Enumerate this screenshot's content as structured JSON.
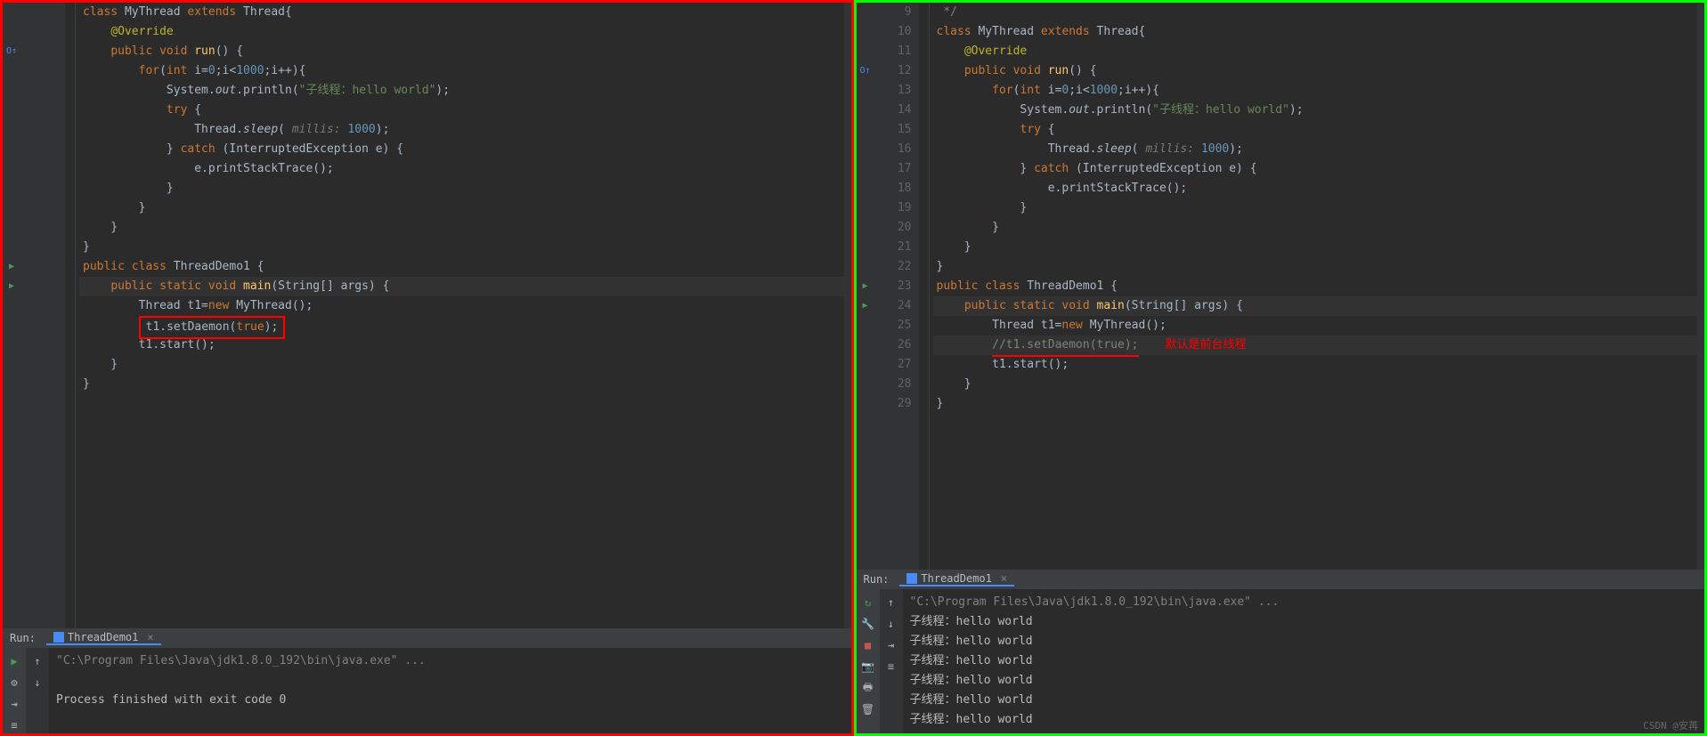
{
  "left": {
    "lines_start": 1,
    "code": [
      {
        "n": "",
        "tokens": [
          {
            "t": "class ",
            "c": "kw"
          },
          {
            "t": "MyThread ",
            "c": ""
          },
          {
            "t": "extends ",
            "c": "kw"
          },
          {
            "t": "Thread",
            "c": ""
          },
          {
            "t": "{",
            "c": ""
          }
        ]
      },
      {
        "n": "",
        "tokens": [
          {
            "t": "    ",
            "c": ""
          },
          {
            "t": "@Override",
            "c": "anno"
          }
        ]
      },
      {
        "n": "",
        "icon": "override",
        "tokens": [
          {
            "t": "    ",
            "c": ""
          },
          {
            "t": "public void ",
            "c": "kw"
          },
          {
            "t": "run",
            "c": "fn"
          },
          {
            "t": "() {",
            "c": ""
          }
        ]
      },
      {
        "n": "",
        "tokens": [
          {
            "t": "        ",
            "c": ""
          },
          {
            "t": "for",
            "c": "kw"
          },
          {
            "t": "(",
            "c": ""
          },
          {
            "t": "int ",
            "c": "kw"
          },
          {
            "t": "i=",
            "c": ""
          },
          {
            "t": "0",
            "c": "num"
          },
          {
            "t": ";i<",
            "c": ""
          },
          {
            "t": "1000",
            "c": "num"
          },
          {
            "t": ";i++){",
            "c": ""
          }
        ]
      },
      {
        "n": "",
        "tokens": [
          {
            "t": "            System.",
            "c": ""
          },
          {
            "t": "out",
            "c": "static"
          },
          {
            "t": ".println(",
            "c": ""
          },
          {
            "t": "\"子线程：hello world\"",
            "c": "str"
          },
          {
            "t": ");",
            "c": ""
          }
        ]
      },
      {
        "n": "",
        "tokens": [
          {
            "t": "            ",
            "c": ""
          },
          {
            "t": "try ",
            "c": "kw"
          },
          {
            "t": "{",
            "c": ""
          }
        ]
      },
      {
        "n": "",
        "tokens": [
          {
            "t": "                Thread.",
            "c": ""
          },
          {
            "t": "sleep",
            "c": "static"
          },
          {
            "t": "( ",
            "c": ""
          },
          {
            "t": "millis: ",
            "c": "hint"
          },
          {
            "t": "1000",
            "c": "num"
          },
          {
            "t": ");",
            "c": ""
          }
        ]
      },
      {
        "n": "",
        "tokens": [
          {
            "t": "            } ",
            "c": ""
          },
          {
            "t": "catch ",
            "c": "kw"
          },
          {
            "t": "(InterruptedException e) {",
            "c": ""
          }
        ]
      },
      {
        "n": "",
        "tokens": [
          {
            "t": "                e.printStackTrace();",
            "c": ""
          }
        ]
      },
      {
        "n": "",
        "tokens": [
          {
            "t": "            }",
            "c": ""
          }
        ]
      },
      {
        "n": "",
        "tokens": [
          {
            "t": "        }",
            "c": ""
          }
        ]
      },
      {
        "n": "",
        "tokens": [
          {
            "t": "    }",
            "c": ""
          }
        ]
      },
      {
        "n": "",
        "tokens": [
          {
            "t": "}",
            "c": ""
          }
        ]
      },
      {
        "n": "",
        "icon": "run",
        "tokens": [
          {
            "t": "public class ",
            "c": "kw"
          },
          {
            "t": "ThreadDemo1 {",
            "c": ""
          }
        ]
      },
      {
        "n": "",
        "icon": "run",
        "hl": true,
        "tokens": [
          {
            "t": "    ",
            "c": ""
          },
          {
            "t": "public static void ",
            "c": "kw"
          },
          {
            "t": "main",
            "c": "fn"
          },
          {
            "t": "(String[] args) {",
            "c": ""
          }
        ]
      },
      {
        "n": "",
        "tokens": [
          {
            "t": "        Thread t1=",
            "c": ""
          },
          {
            "t": "new ",
            "c": "kw"
          },
          {
            "t": "MyThread();",
            "c": ""
          }
        ]
      },
      {
        "n": "",
        "box": true,
        "tokens": [
          {
            "t": "        t1.setDaemon(",
            "c": ""
          },
          {
            "t": "true",
            "c": "kw"
          },
          {
            "t": ");",
            "c": ""
          }
        ]
      },
      {
        "n": "",
        "tokens": [
          {
            "t": "        t1.start();",
            "c": ""
          }
        ]
      },
      {
        "n": "",
        "tokens": [
          {
            "t": "    }",
            "c": ""
          }
        ]
      },
      {
        "n": "",
        "tokens": [
          {
            "t": "}",
            "c": ""
          }
        ]
      }
    ],
    "run": {
      "label": "Run:",
      "tab": "ThreadDemo1",
      "output": [
        {
          "text": "\"C:\\Program Files\\Java\\jdk1.8.0_192\\bin\\java.exe\" ...",
          "cls": "out-cmd"
        },
        {
          "text": " ",
          "cls": ""
        },
        {
          "text": "Process finished with exit code 0",
          "cls": ""
        },
        {
          "text": "",
          "cls": ""
        }
      ]
    }
  },
  "right": {
    "lines": [
      {
        "n": "9",
        "tokens": [
          {
            "t": " */",
            "c": "cmt"
          }
        ]
      },
      {
        "n": "10",
        "tokens": [
          {
            "t": "class ",
            "c": "kw"
          },
          {
            "t": "MyThread ",
            "c": ""
          },
          {
            "t": "extends ",
            "c": "kw"
          },
          {
            "t": "Thread",
            "c": ""
          },
          {
            "t": "{",
            "c": ""
          }
        ]
      },
      {
        "n": "11",
        "tokens": [
          {
            "t": "    ",
            "c": ""
          },
          {
            "t": "@Override",
            "c": "anno"
          }
        ]
      },
      {
        "n": "12",
        "icon": "override",
        "tokens": [
          {
            "t": "    ",
            "c": ""
          },
          {
            "t": "public void ",
            "c": "kw"
          },
          {
            "t": "run",
            "c": "fn"
          },
          {
            "t": "() {",
            "c": ""
          }
        ]
      },
      {
        "n": "13",
        "tokens": [
          {
            "t": "        ",
            "c": ""
          },
          {
            "t": "for",
            "c": "kw"
          },
          {
            "t": "(",
            "c": ""
          },
          {
            "t": "int ",
            "c": "kw"
          },
          {
            "t": "i=",
            "c": ""
          },
          {
            "t": "0",
            "c": "num"
          },
          {
            "t": ";i<",
            "c": ""
          },
          {
            "t": "1000",
            "c": "num"
          },
          {
            "t": ";i++){",
            "c": ""
          }
        ]
      },
      {
        "n": "14",
        "tokens": [
          {
            "t": "            System.",
            "c": ""
          },
          {
            "t": "out",
            "c": "static"
          },
          {
            "t": ".println(",
            "c": ""
          },
          {
            "t": "\"子线程：hello world\"",
            "c": "str"
          },
          {
            "t": ");",
            "c": ""
          }
        ]
      },
      {
        "n": "15",
        "tokens": [
          {
            "t": "            ",
            "c": ""
          },
          {
            "t": "try ",
            "c": "kw"
          },
          {
            "t": "{",
            "c": ""
          }
        ]
      },
      {
        "n": "16",
        "tokens": [
          {
            "t": "                Thread.",
            "c": ""
          },
          {
            "t": "sleep",
            "c": "static"
          },
          {
            "t": "( ",
            "c": ""
          },
          {
            "t": "millis: ",
            "c": "hint"
          },
          {
            "t": "1000",
            "c": "num"
          },
          {
            "t": ");",
            "c": ""
          }
        ]
      },
      {
        "n": "17",
        "tokens": [
          {
            "t": "            } ",
            "c": ""
          },
          {
            "t": "catch ",
            "c": "kw"
          },
          {
            "t": "(InterruptedException e) {",
            "c": ""
          }
        ]
      },
      {
        "n": "18",
        "tokens": [
          {
            "t": "                e.printStackTrace();",
            "c": ""
          }
        ]
      },
      {
        "n": "19",
        "tokens": [
          {
            "t": "            }",
            "c": ""
          }
        ]
      },
      {
        "n": "20",
        "tokens": [
          {
            "t": "        }",
            "c": ""
          }
        ]
      },
      {
        "n": "21",
        "tokens": [
          {
            "t": "    }",
            "c": ""
          }
        ]
      },
      {
        "n": "22",
        "tokens": [
          {
            "t": "}",
            "c": ""
          }
        ]
      },
      {
        "n": "23",
        "icon": "run",
        "tokens": [
          {
            "t": "public class ",
            "c": "kw"
          },
          {
            "t": "ThreadDemo1 {",
            "c": ""
          }
        ]
      },
      {
        "n": "24",
        "icon": "run",
        "hl": true,
        "tokens": [
          {
            "t": "    ",
            "c": ""
          },
          {
            "t": "public static void ",
            "c": "kw"
          },
          {
            "t": "main",
            "c": "fn"
          },
          {
            "t": "(String[] args) {",
            "c": ""
          }
        ]
      },
      {
        "n": "25",
        "tokens": [
          {
            "t": "        Thread t1=",
            "c": ""
          },
          {
            "t": "new ",
            "c": "kw"
          },
          {
            "t": "MyThread();",
            "c": ""
          }
        ]
      },
      {
        "n": "26",
        "hl": true,
        "underline": true,
        "annotation": "默认是前台线程",
        "tokens": [
          {
            "t": "        ",
            "c": ""
          },
          {
            "t": "//t1.setDaemon(true);",
            "c": "cmt"
          }
        ]
      },
      {
        "n": "27",
        "tokens": [
          {
            "t": "        t1.start();",
            "c": ""
          }
        ]
      },
      {
        "n": "28",
        "tokens": [
          {
            "t": "    }",
            "c": ""
          }
        ]
      },
      {
        "n": "29",
        "tokens": [
          {
            "t": "}",
            "c": ""
          }
        ]
      }
    ],
    "run": {
      "label": "Run:",
      "tab": "ThreadDemo1",
      "output": [
        {
          "text": "\"C:\\Program Files\\Java\\jdk1.8.0_192\\bin\\java.exe\" ...",
          "cls": "out-cmd"
        },
        {
          "text": "子线程：hello world",
          "cls": ""
        },
        {
          "text": "子线程：hello world",
          "cls": ""
        },
        {
          "text": "子线程：hello world",
          "cls": ""
        },
        {
          "text": "子线程：hello world",
          "cls": ""
        },
        {
          "text": "子线程：hello world",
          "cls": ""
        },
        {
          "text": "子线程：hello world",
          "cls": ""
        }
      ]
    }
  },
  "watermark": "CSDN @安苒"
}
